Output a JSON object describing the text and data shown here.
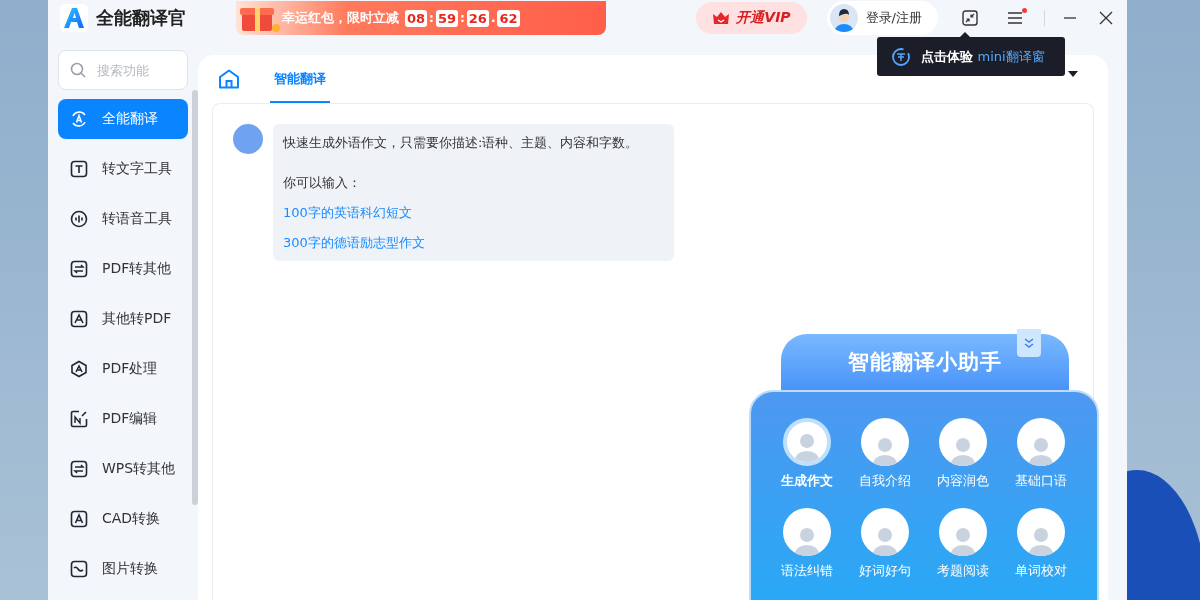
{
  "app": {
    "title": "全能翻译官"
  },
  "promo": {
    "text": "幸运红包，限时立减",
    "timer": [
      "08",
      "59",
      "26",
      "62"
    ],
    "separators": [
      ":",
      ":",
      "."
    ]
  },
  "vip_button": {
    "label": "开通VIP"
  },
  "login_button": {
    "label": "登录/注册"
  },
  "menu": {
    "notification": true
  },
  "tooltip": {
    "text": "点击体验",
    "highlight": "mini翻译窗"
  },
  "sidebar": {
    "search": {
      "placeholder": "搜索功能"
    },
    "items": [
      {
        "label": "全能翻译",
        "kind": "translate",
        "selected": true
      },
      {
        "label": "转文字工具",
        "kind": "text",
        "selected": false
      },
      {
        "label": "转语音工具",
        "kind": "voice",
        "selected": false
      },
      {
        "label": "PDF转其他",
        "kind": "swap",
        "selected": false
      },
      {
        "label": "其他转PDF",
        "kind": "pdf",
        "selected": false
      },
      {
        "label": "PDF处理",
        "kind": "hex",
        "selected": false
      },
      {
        "label": "PDF编辑",
        "kind": "edit",
        "selected": false
      },
      {
        "label": "WPS转其他",
        "kind": "swap",
        "selected": false
      },
      {
        "label": "CAD转换",
        "kind": "letter",
        "selected": false
      },
      {
        "label": "图片转换",
        "kind": "image",
        "selected": false
      }
    ]
  },
  "tabs": [
    {
      "label": "智能翻译",
      "selected": true
    }
  ],
  "chat": {
    "message": {
      "intro": "快速生成外语作文，只需要你描述:语种、主题、内容和字数。",
      "prompt": "你可以输入：",
      "suggestions": [
        "100字的英语科幻短文",
        "300字的德语励志型作文"
      ]
    }
  },
  "assistant": {
    "title": "智能翻译小助手",
    "items": [
      {
        "label": "生成作文",
        "selected": true
      },
      {
        "label": "自我介绍",
        "selected": false
      },
      {
        "label": "内容润色",
        "selected": false
      },
      {
        "label": "基础口语",
        "selected": false
      },
      {
        "label": "语法纠错",
        "selected": false
      },
      {
        "label": "好词好句",
        "selected": false
      },
      {
        "label": "考题阅读",
        "selected": false
      },
      {
        "label": "单词校对",
        "selected": false
      }
    ]
  }
}
